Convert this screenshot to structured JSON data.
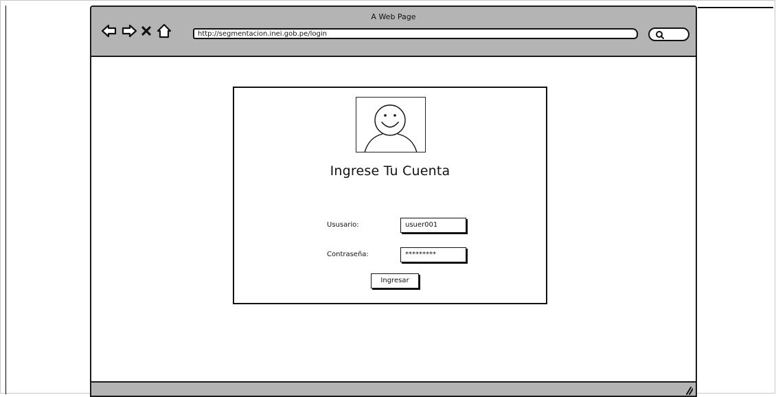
{
  "window": {
    "title": "A Web Page"
  },
  "toolbar": {
    "url": "http://segmentacion.inei.gob.pe/login",
    "icons": [
      "back-arrow-icon",
      "forward-arrow-icon",
      "close-icon",
      "home-icon",
      "search-icon"
    ]
  },
  "login": {
    "title": "Ingrese Tu Cuenta",
    "username_label": "Ususario:",
    "username_value": "usuer001",
    "password_label": "Contraseña:",
    "password_value": "*********",
    "submit_label": "Ingresar",
    "avatar_icon": "smiley-user-icon"
  },
  "colors": {
    "chrome": "#b4b4b4",
    "stroke": "#111111",
    "background": "#ffffff"
  }
}
